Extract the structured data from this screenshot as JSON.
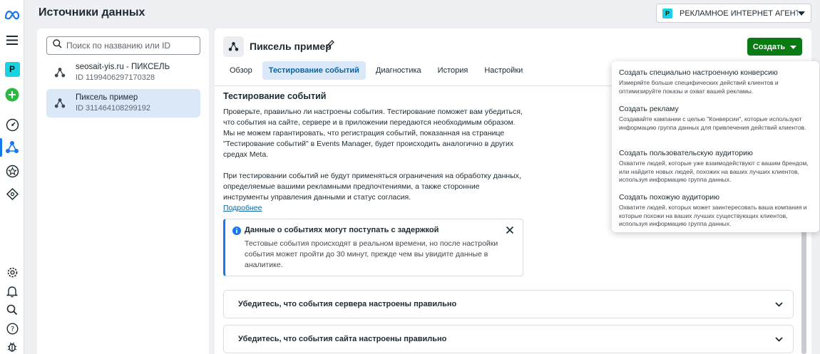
{
  "header": {
    "title": "Источники данных",
    "account": {
      "badge": "P",
      "name": "РЕКЛАМНОЕ ИНТЕРНЕТ АГЕНТ..."
    }
  },
  "rail": {
    "account_badge": "P",
    "icons": [
      "meta-logo-icon",
      "menu-icon",
      "account-avatar",
      "add-icon",
      "dashboard-icon",
      "events-manager-icon",
      "star-icon",
      "tag-icon",
      "settings-icon",
      "bell-icon",
      "search-icon",
      "help-icon",
      "bug-icon"
    ]
  },
  "sources": {
    "search_placeholder": "Поиск по названию или ID",
    "items": [
      {
        "name": "seosait-yis.ru - ПИКСЕЛЬ",
        "id": "ID 1199406297170328"
      },
      {
        "name": "Пиксель пример",
        "id": "ID 311464108299192"
      }
    ]
  },
  "main": {
    "pixel_title": "Пиксель пример",
    "create_label": "Создать",
    "tabs": [
      "Обзор",
      "Тестирование событий",
      "Диагностика",
      "История",
      "Настройки"
    ],
    "section_title": "Тестирование событий",
    "para1": "Проверьте, правильно ли настроены события. Тестирование поможет вам убедиться, что события на сайте, сервере и в приложении передаются необходимым образом. Мы не можем гарантировать, что регистрация событий, показанная на странице \"Тестирование событий\" в Events Manager, будет происходить аналогично в других средах Meta.",
    "para2": "При тестировании событий не будут применяться ограничения на обработку данных, определяемые вашими рекламными предпочтениями, а также сторонние инструменты управления данными и статус согласия.",
    "more_link": "Подробнее",
    "notice": {
      "title": "Данные о событиях могут поступать с задержкой",
      "body": "Тестовые события происходят в реальном времени, но после настройки события может пройти до 30 минут, прежде чем вы увидите данные в аналитике."
    },
    "accordions": [
      "Убедитесь, что события сервера настроены правильно",
      "Убедитесь, что события сайта настроены правильно"
    ]
  },
  "create_menu": {
    "items": [
      {
        "title": "Создать специально настроенную конверсию",
        "desc": "Измеряйте больше специфических действий клиентов и оптимизируйте показы и охват вашей рекламы."
      },
      {
        "title": "Создать рекламу",
        "desc": "Создавайте кампании с целью \"Конверсии\", которые используют информацию группа данных для привлечения действий клиентов."
      },
      {
        "title": "Создать пользовательскую аудиторию",
        "desc": "Охватите людей, которые уже взаимодействуют с вашим брендом, или найдите новых людей, похожих на ваших лучших клиентов, используя информацию группа данных."
      },
      {
        "title": "Создать похожую аудиторию",
        "desc": "Охватите людей, которых может заинтересовать ваша компания и которые похожи на ваших лучших существующих клиентов, используя информацию группа данных."
      }
    ]
  },
  "colors": {
    "accent": "#1877f2",
    "create_button": "#0a7a15",
    "selected_bg": "#dbe8f8",
    "tab_active_text": "#0866a6"
  }
}
